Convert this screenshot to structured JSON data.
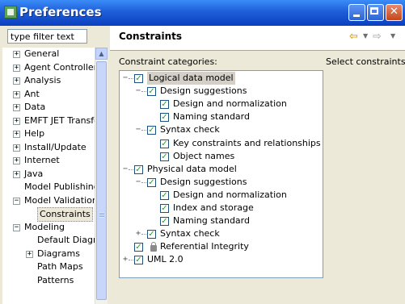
{
  "window": {
    "title": "Preferences"
  },
  "filter": {
    "placeholder": "type filter text",
    "value": "type filter text"
  },
  "nav": [
    {
      "label": "General",
      "expander": "+",
      "level": 0
    },
    {
      "label": "Agent Controller",
      "expander": "+",
      "level": 0
    },
    {
      "label": "Analysis",
      "expander": "+",
      "level": 0
    },
    {
      "label": "Ant",
      "expander": "+",
      "level": 0
    },
    {
      "label": "Data",
      "expander": "+",
      "level": 0
    },
    {
      "label": "EMFT JET Transfo",
      "expander": "+",
      "level": 0
    },
    {
      "label": "Help",
      "expander": "+",
      "level": 0
    },
    {
      "label": "Install/Update",
      "expander": "+",
      "level": 0
    },
    {
      "label": "Internet",
      "expander": "+",
      "level": 0
    },
    {
      "label": "Java",
      "expander": "+",
      "level": 0
    },
    {
      "label": "Model Publishing",
      "expander": "",
      "level": 0
    },
    {
      "label": "Model Validation",
      "expander": "-",
      "level": 0
    },
    {
      "label": "Constraints",
      "expander": "",
      "level": 1,
      "selected": true
    },
    {
      "label": "Modeling",
      "expander": "-",
      "level": 0
    },
    {
      "label": "Default Diagra",
      "expander": "",
      "level": 1
    },
    {
      "label": "Diagrams",
      "expander": "+",
      "level": 1
    },
    {
      "label": "Path Maps",
      "expander": "",
      "level": 1
    },
    {
      "label": "Patterns",
      "expander": "",
      "level": 1
    }
  ],
  "page": {
    "title": "Constraints",
    "categories_label": "Constraint categories:",
    "select_label": "Select constraints"
  },
  "tree": [
    {
      "label": "Logical data model",
      "depth": 0,
      "expander": "-",
      "checked": true,
      "selected": true
    },
    {
      "label": "Design suggestions",
      "depth": 1,
      "expander": "-",
      "checked": true
    },
    {
      "label": "Design and normalization",
      "depth": 2,
      "expander": "",
      "checked": true
    },
    {
      "label": "Naming standard",
      "depth": 2,
      "expander": "",
      "checked": true
    },
    {
      "label": "Syntax check",
      "depth": 1,
      "expander": "-",
      "checked": true
    },
    {
      "label": "Key constraints and relationships",
      "depth": 2,
      "expander": "",
      "checked": true
    },
    {
      "label": "Object names",
      "depth": 2,
      "expander": "",
      "checked": true
    },
    {
      "label": "Physical data model",
      "depth": 0,
      "expander": "-",
      "checked": true
    },
    {
      "label": "Design suggestions",
      "depth": 1,
      "expander": "-",
      "checked": true
    },
    {
      "label": "Design and normalization",
      "depth": 2,
      "expander": "",
      "checked": true
    },
    {
      "label": "Index and storage",
      "depth": 2,
      "expander": "",
      "checked": true
    },
    {
      "label": "Naming standard",
      "depth": 2,
      "expander": "",
      "checked": true
    },
    {
      "label": "Syntax check",
      "depth": 1,
      "expander": "+",
      "checked": true
    },
    {
      "label": "Referential Integrity",
      "depth": 0,
      "expander": "",
      "checked": true,
      "locked": true
    },
    {
      "label": "UML 2.0",
      "depth": 0,
      "expander": "+",
      "checked": true
    }
  ]
}
